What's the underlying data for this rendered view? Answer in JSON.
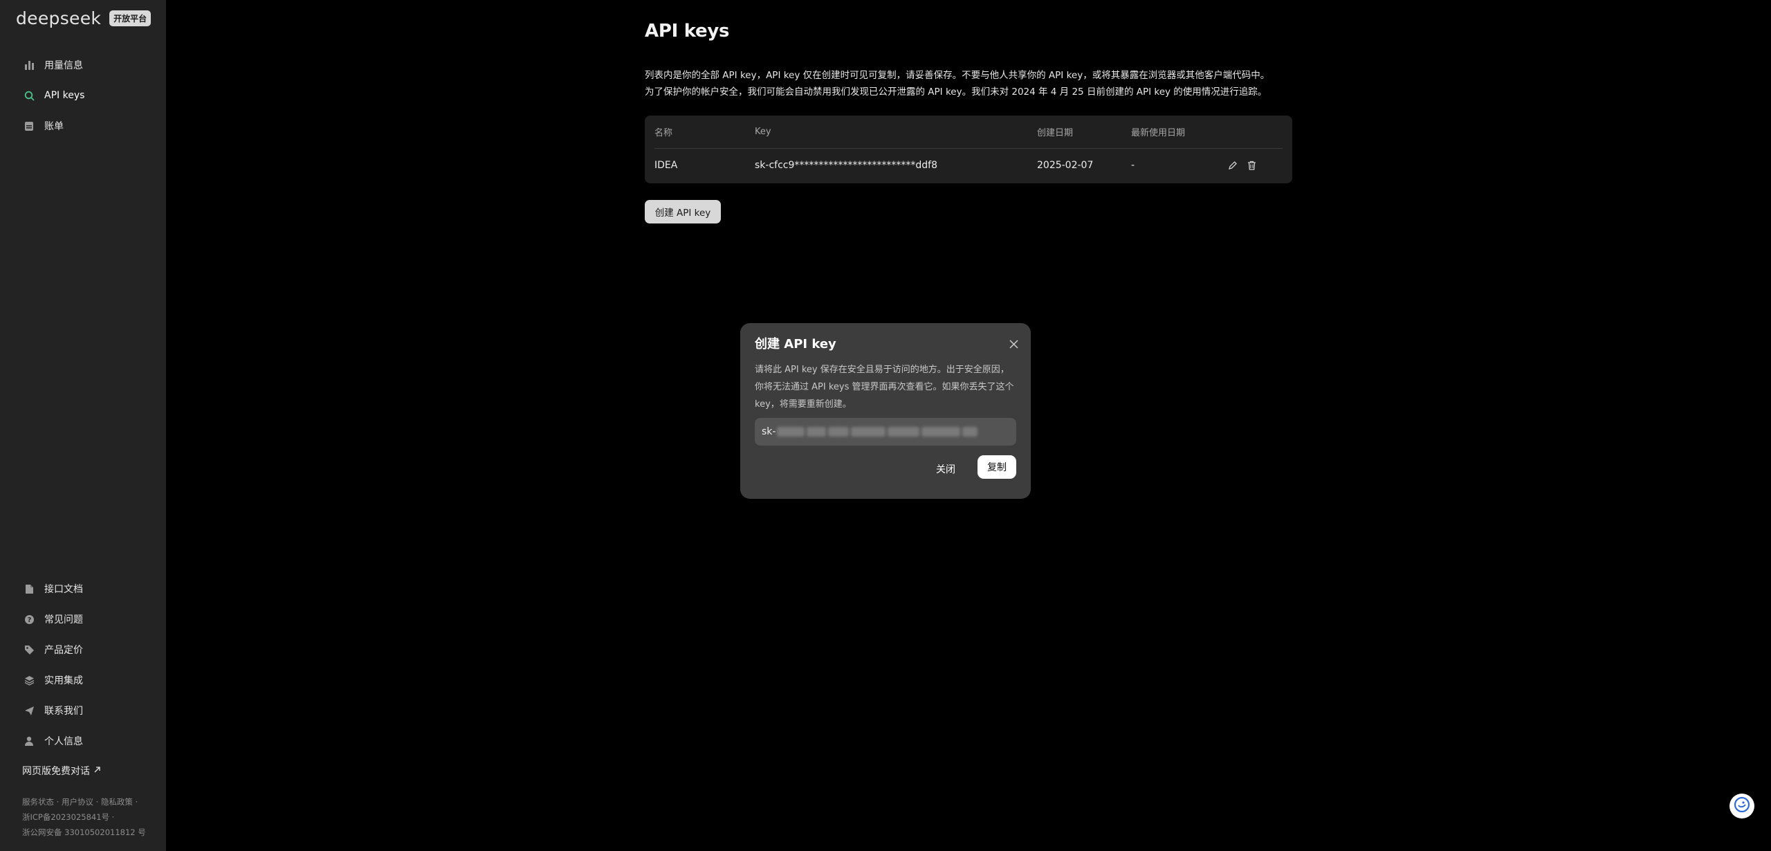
{
  "sidebar": {
    "brand": "deepseek",
    "badge": "开放平台",
    "nav_top": [
      {
        "label": "用量信息",
        "icon": "bar-chart-icon"
      },
      {
        "label": "API keys",
        "icon": "search-icon",
        "active": true
      },
      {
        "label": "账单",
        "icon": "billing-icon"
      }
    ],
    "nav_bottom": [
      {
        "label": "接口文档",
        "icon": "document-icon"
      },
      {
        "label": "常见问题",
        "icon": "question-icon"
      },
      {
        "label": "产品定价",
        "icon": "tag-icon"
      },
      {
        "label": "实用集成",
        "icon": "layers-icon"
      },
      {
        "label": "联系我们",
        "icon": "send-icon"
      },
      {
        "label": "个人信息",
        "icon": "user-icon"
      }
    ],
    "web_chat": "网页版免费对话",
    "footer": {
      "service_status": "服务状态",
      "user_agreement": "用户协议",
      "privacy_policy": "隐私政策",
      "icp": "浙ICP备2023025841号",
      "police": "浙公网安备 33010502011812 号"
    }
  },
  "main": {
    "title": "API keys",
    "desc_line1": "列表内是你的全部 API key，API key 仅在创建时可见可复制，请妥善保存。不要与他人共享你的 API key，或将其暴露在浏览器或其他客户端代码中。",
    "desc_line2": "为了保护你的帐户安全，我们可能会自动禁用我们发现已公开泄露的 API key。我们未对 2024 年 4 月 25 日前创建的 API key 的使用情况进行追踪。",
    "table": {
      "headers": {
        "name": "名称",
        "key": "Key",
        "created": "创建日期",
        "last_used": "最新使用日期"
      },
      "rows": [
        {
          "name": "IDEA",
          "key": "sk-cfcc9*************************ddf8",
          "created": "2025-02-07",
          "last_used": "-"
        }
      ]
    },
    "create_button": "创建 API key"
  },
  "modal": {
    "title": "创建 API key",
    "body": "请将此 API key 保存在安全且易于访问的地方。出于安全原因，你将无法通过 API keys 管理界面再次查看它。如果你丢失了这个 key，将需要重新创建。",
    "key_prefix": "sk-",
    "cancel": "关闭",
    "copy": "复制"
  },
  "colors": {
    "background": "#000000",
    "sidebar": "#232323",
    "table": "#202020",
    "modal": "#3d3d3d",
    "accent": "#4cc38a"
  }
}
